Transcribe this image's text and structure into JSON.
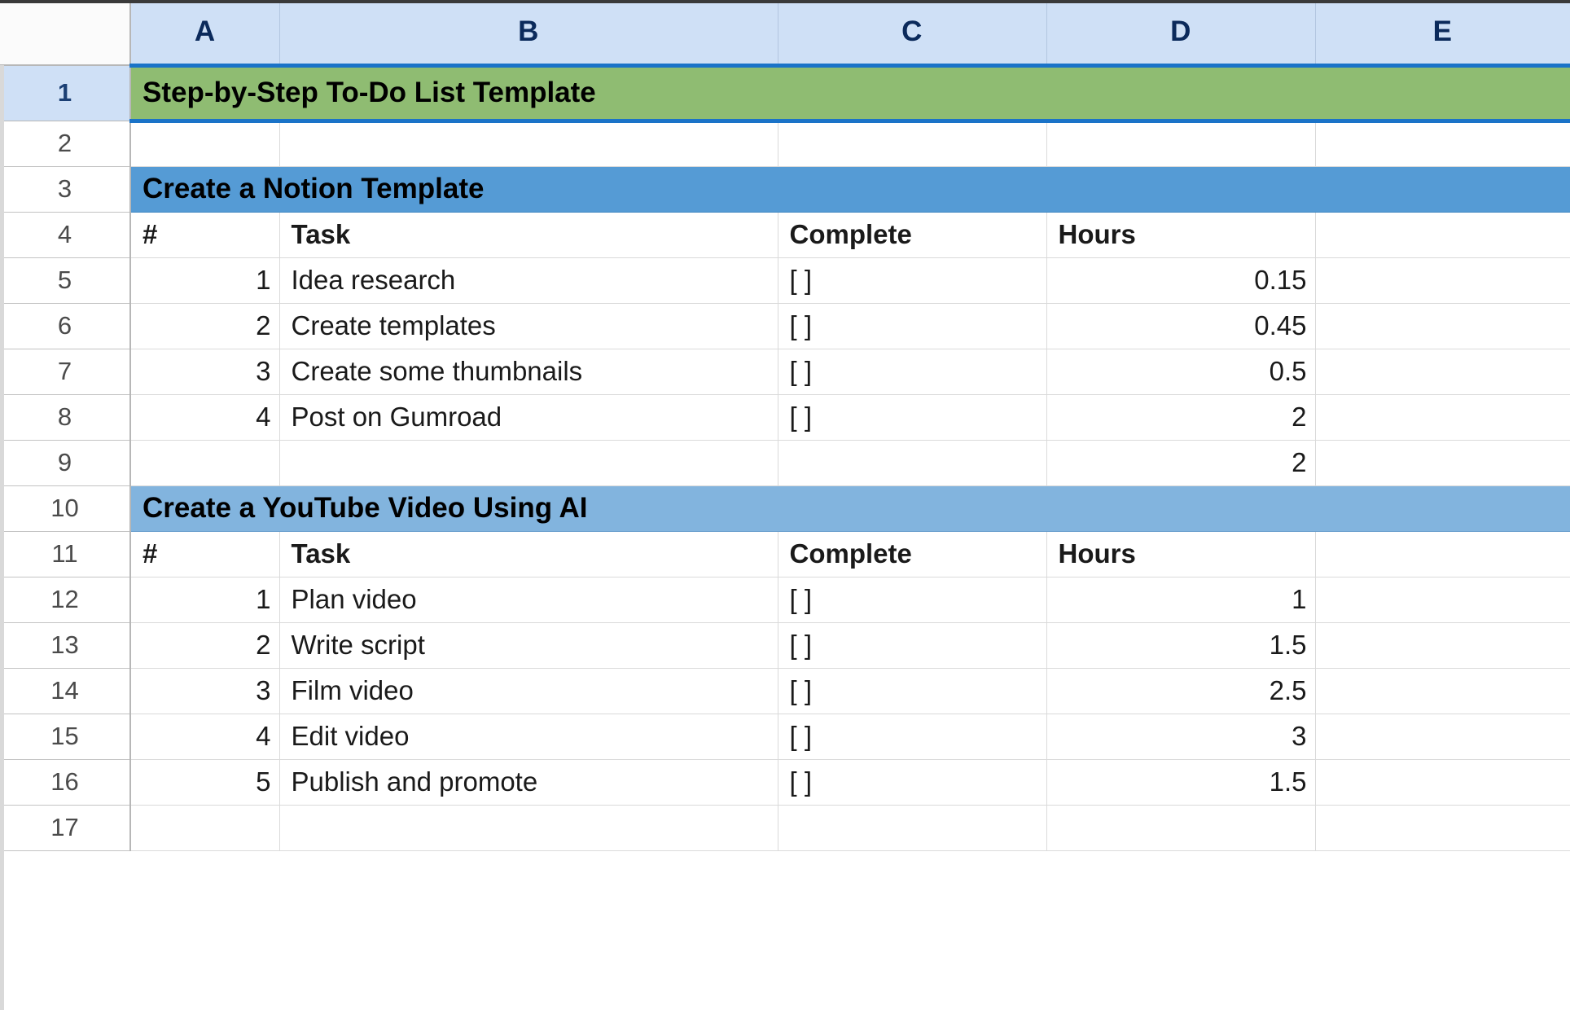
{
  "sheet": {
    "column_headers": [
      "A",
      "B",
      "C",
      "D",
      "E"
    ],
    "row_numbers": [
      "1",
      "2",
      "3",
      "4",
      "5",
      "6",
      "7",
      "8",
      "9",
      "10",
      "11",
      "12",
      "13",
      "14",
      "15",
      "16",
      "17"
    ],
    "active_row": "1",
    "colors": {
      "title_banner": "#8fbc72",
      "section1_banner": "#559bd5",
      "section2_banner": "#82b4de",
      "selection_border": "#1a73c8",
      "header_fill": "#cfe0f6",
      "header_text": "#0b2a5b"
    }
  },
  "title": {
    "text": "Step-by-Step To-Do List Template"
  },
  "sections": [
    {
      "banner": "Create a Notion Template",
      "columns": {
        "num": "#",
        "task": "Task",
        "complete": "Complete",
        "hours": "Hours"
      },
      "rows": [
        {
          "num": "1",
          "task": "Idea research",
          "complete": "[ ]",
          "hours": "0.15"
        },
        {
          "num": "2",
          "task": "Create templates",
          "complete": "[ ]",
          "hours": "0.45"
        },
        {
          "num": "3",
          "task": "Create some thumbnails",
          "complete": "[ ]",
          "hours": "0.5"
        },
        {
          "num": "4",
          "task": "Post on Gumroad",
          "complete": "[ ]",
          "hours": "2"
        }
      ],
      "total": {
        "num": "",
        "task": "",
        "complete": "",
        "hours": "2"
      }
    },
    {
      "banner": "Create a YouTube Video Using AI",
      "columns": {
        "num": "#",
        "task": "Task",
        "complete": "Complete",
        "hours": "Hours"
      },
      "rows": [
        {
          "num": "1",
          "task": "Plan video",
          "complete": "[ ]",
          "hours": "1"
        },
        {
          "num": "2",
          "task": "Write script",
          "complete": "[ ]",
          "hours": "1.5"
        },
        {
          "num": "3",
          "task": "Film video",
          "complete": "[ ]",
          "hours": "2.5"
        },
        {
          "num": "4",
          "task": "Edit video",
          "complete": "[ ]",
          "hours": "3"
        },
        {
          "num": "5",
          "task": "Publish and promote",
          "complete": "[ ]",
          "hours": "1.5"
        }
      ]
    }
  ]
}
